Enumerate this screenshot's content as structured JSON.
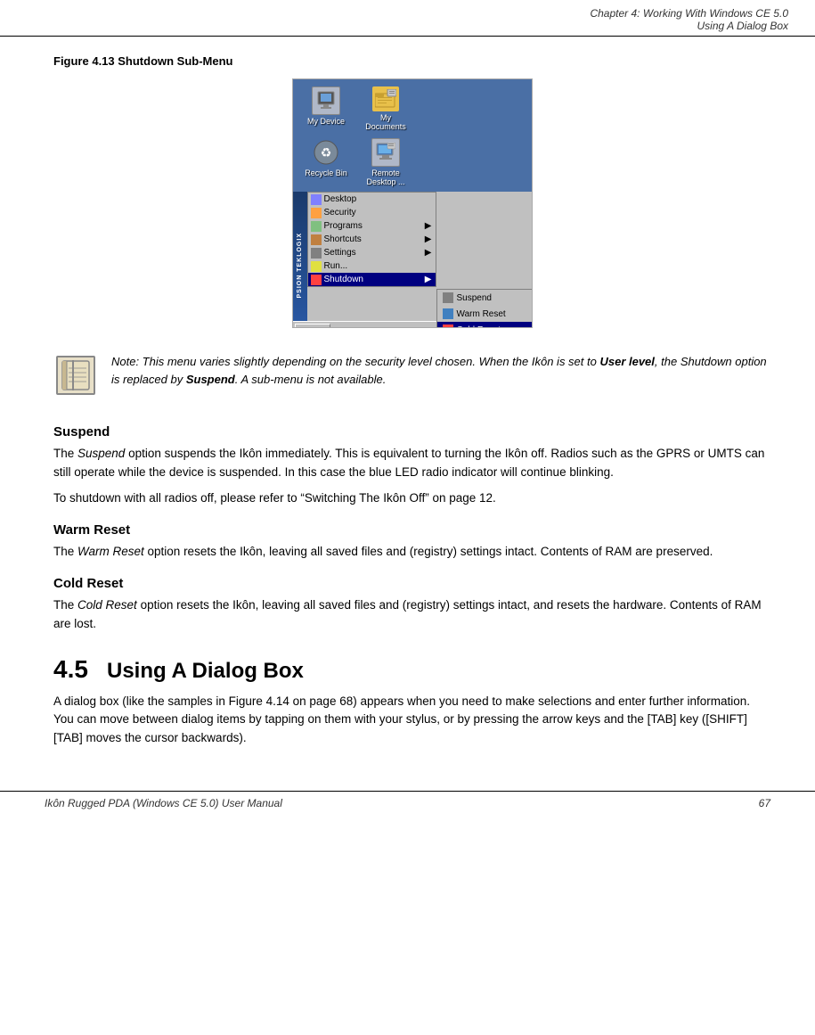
{
  "header": {
    "line1": "Chapter 4:  Working With Windows CE 5.0",
    "line2": "Using A Dialog Box"
  },
  "figure": {
    "caption": "Figure 4.13 Shutdown Sub-Menu"
  },
  "desktop": {
    "icons": [
      {
        "label": "My Device"
      },
      {
        "label": "My\nDocuments"
      },
      {
        "label": "Recycle Bin"
      },
      {
        "label": "Remote\nDesktop ..."
      }
    ]
  },
  "menu_items": [
    {
      "label": "Desktop",
      "has_arrow": false
    },
    {
      "label": "Security",
      "has_arrow": false
    },
    {
      "label": "Programs",
      "has_arrow": true
    },
    {
      "label": "Shortcuts",
      "has_arrow": true
    },
    {
      "label": "Settings",
      "has_arrow": true
    },
    {
      "label": "Run...",
      "has_arrow": false
    },
    {
      "label": "Shutdown",
      "has_arrow": true,
      "highlighted": true
    }
  ],
  "submenu_items": [
    {
      "label": "Suspend",
      "highlighted": false
    },
    {
      "label": "Warm Reset",
      "highlighted": false
    },
    {
      "label": "Cold Reset",
      "highlighted": false
    }
  ],
  "note": {
    "text_parts": [
      "Note: This menu varies slightly depending on the security level chosen. When the Ikôn is set to ",
      "User level",
      ", the Shutdown option is replaced by ",
      "Suspend",
      ". A sub-menu is not available."
    ]
  },
  "sections": [
    {
      "id": "suspend",
      "heading": "Suspend",
      "paragraphs": [
        "The Suspend option suspends the Ikôn immediately. This is equivalent to turning the Ikôn off. Radios such as the GPRS or UMTS can still operate while the device is suspended. In this case the blue LED radio indicator will continue blinking.",
        "To shutdown with all radios off, please refer to “Switching The Ikôn Off” on page 12."
      ]
    },
    {
      "id": "warm-reset",
      "heading": "Warm Reset",
      "paragraphs": [
        "The Warm Reset option resets the Ikôn, leaving all saved files and (registry) settings intact. Contents of RAM are preserved."
      ]
    },
    {
      "id": "cold-reset",
      "heading": "Cold Reset",
      "paragraphs": [
        "The Cold Reset option resets the Ikôn, leaving all saved files and (registry) settings intact, and resets the hardware. Contents of RAM are lost."
      ]
    }
  ],
  "major_section": {
    "number": "4.5",
    "title": "Using A Dialog Box",
    "body": "A dialog box (like the samples in Figure 4.14 on page 68) appears when you need to make selections and enter further information. You can move between dialog items by tapping on them with your stylus, or by pressing the arrow keys and the [TAB] key ([SHIFT] [TAB] moves the cursor backwards)."
  },
  "footer": {
    "left": "Ikôn Rugged PDA (Windows CE 5.0) User Manual",
    "right": "67"
  }
}
